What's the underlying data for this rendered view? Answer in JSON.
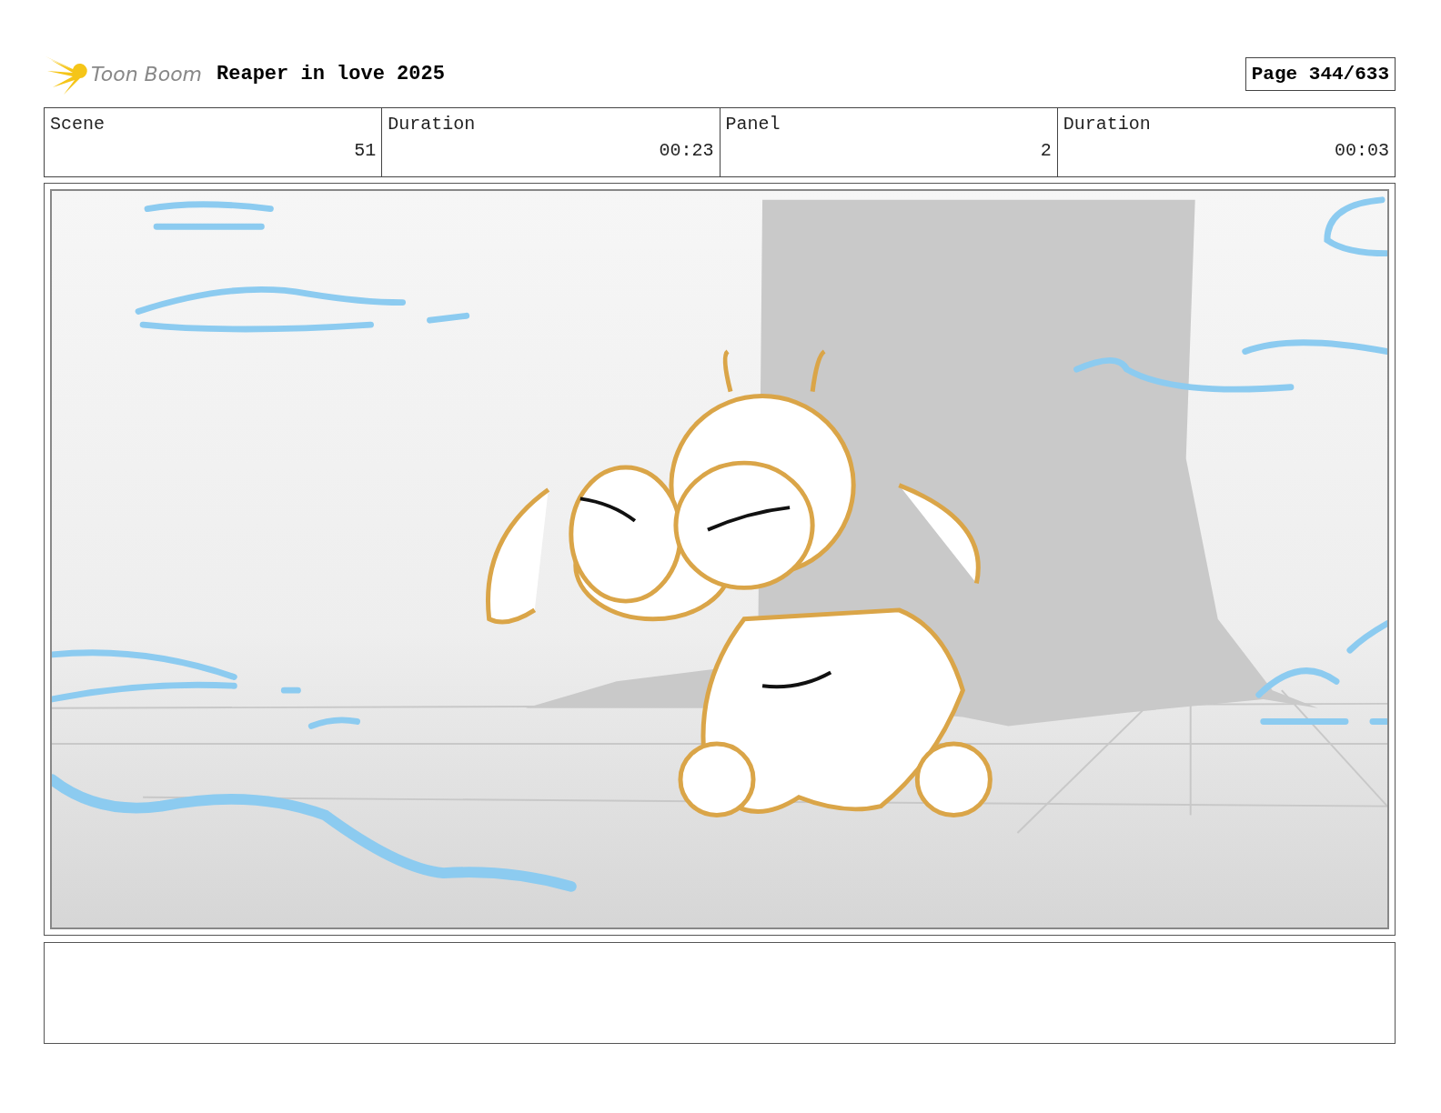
{
  "header": {
    "logo_text": "Toon Boom",
    "title": "Reaper in love 2025",
    "page": "Page 344/633"
  },
  "info_table": {
    "columns": [
      "Scene",
      "Duration",
      "Panel",
      "Duration"
    ],
    "rows": [
      [
        "51",
        "00:23",
        "2",
        "00:03"
      ]
    ]
  }
}
